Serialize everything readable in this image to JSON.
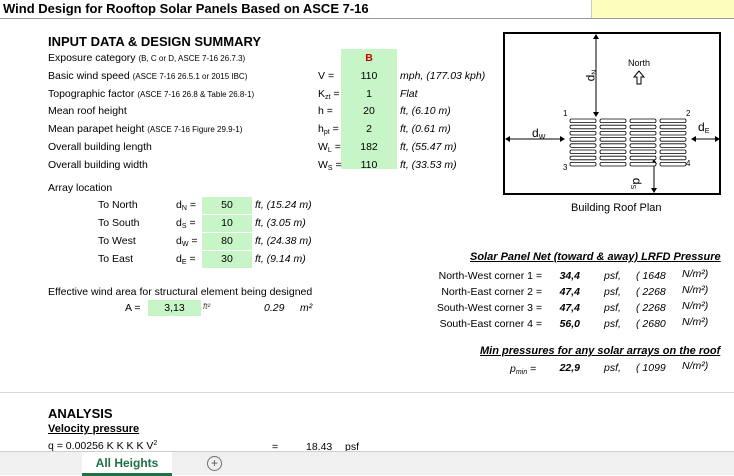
{
  "title": "Wind Design for Rooftop Solar Panels Based on ASCE 7-16",
  "input": {
    "heading": "INPUT DATA & DESIGN SUMMARY",
    "rows": [
      {
        "label": "Exposure category",
        "note": "(B, C or D, ASCE 7-16 26.7.3)",
        "sym": "",
        "eq": "",
        "value": "B",
        "unit": ""
      },
      {
        "label": "Basic wind speed",
        "note": "(ASCE 7-16 26.5.1 or 2015 IBC)",
        "sym": "V",
        "eq": "=",
        "value": "110",
        "unit": "mph, (177.03 kph)"
      },
      {
        "label": "Topographic factor",
        "note": "(ASCE 7-16 26.8 & Table 26.8-1)",
        "sym": "K",
        "symsub": "zt",
        "eq": "=",
        "value": "1",
        "unit": "Flat"
      },
      {
        "label": "Mean roof height",
        "note": "",
        "sym": "h",
        "eq": "=",
        "value": "20",
        "unit": "ft, (6.10 m)"
      },
      {
        "label": "Mean parapet height",
        "note": "(ASCE 7-16 Figure 29.9-1)",
        "sym": "h",
        "symsub": "pt",
        "eq": "=",
        "value": "2",
        "unit": "ft, (0.61 m)"
      },
      {
        "label": "Overall building length",
        "note": "",
        "sym": "W",
        "symsub": "L",
        "eq": "=",
        "value": "182",
        "unit": "ft, (55.47 m)"
      },
      {
        "label": "Overall building width",
        "note": "",
        "sym": "W",
        "symsub": "S",
        "eq": "=",
        "value": "110",
        "unit": "ft, (33.53 m)"
      }
    ]
  },
  "array": {
    "heading": "Array location",
    "rows": [
      {
        "label": "To North",
        "sym": "d",
        "symsub": "N",
        "eq": "=",
        "value": "50",
        "unit": "ft, (15.24 m)"
      },
      {
        "label": "To South",
        "sym": "d",
        "symsub": "S",
        "eq": "=",
        "value": "10",
        "unit": "ft, (3.05 m)"
      },
      {
        "label": "To West",
        "sym": "d",
        "symsub": "W",
        "eq": "=",
        "value": "80",
        "unit": "ft, (24.38 m)"
      },
      {
        "label": "To East",
        "sym": "d",
        "symsub": "E",
        "eq": "=",
        "value": "30",
        "unit": "ft, (9.14 m)"
      }
    ]
  },
  "effective": {
    "label": "Effective wind area for structural element being designed",
    "sym": "A",
    "eq": "=",
    "value": "3,13",
    "unit_ft": "ft²",
    "value_m": "0.29",
    "unit_m": "m²"
  },
  "diagram": {
    "north_label": "North",
    "caption": "Building  Roof  Plan",
    "corner1": "1",
    "corner2": "2",
    "corner3": "3",
    "corner4": "4",
    "dN": "d",
    "dNsub": "N",
    "dS": "d",
    "dSsub": "S",
    "dW": "d",
    "dWsub": "W",
    "dE": "d",
    "dEsub": "E"
  },
  "pressure": {
    "heading": "Solar Panel Net (toward & away) LRFD Pressure",
    "rows": [
      {
        "label": "North-West corner 1 =",
        "value": "34,4",
        "unit": "psf,",
        "metric": "( 1648",
        "munit": "N/m²)"
      },
      {
        "label": "North-East corner 2 =",
        "value": "47,4",
        "unit": "psf,",
        "metric": "( 2268",
        "munit": "N/m²)"
      },
      {
        "label": "South-West corner 3 =",
        "value": "47,4",
        "unit": "psf,",
        "metric": "( 2268",
        "munit": "N/m²)"
      },
      {
        "label": "South-East corner 4 =",
        "value": "56,0",
        "unit": "psf,",
        "metric": "( 2680",
        "munit": "N/m²)"
      }
    ]
  },
  "minpressure": {
    "heading": "Min pressures for any solar arrays on the roof",
    "sym": "p",
    "symsub": "min",
    "eq": "=",
    "value": "22,9",
    "unit": "psf,",
    "metric": "( 1099",
    "munit": "N/m²)"
  },
  "analysis": {
    "heading": "ANALYSIS",
    "subheading": "Velocity pressure",
    "formula": "q  = 0.00256 K  K  K  K  V",
    "formula_sup": "2",
    "eq": "=",
    "value": "18.43",
    "unit": "psf"
  },
  "tabs": {
    "active": "All Heights",
    "add": "+"
  }
}
